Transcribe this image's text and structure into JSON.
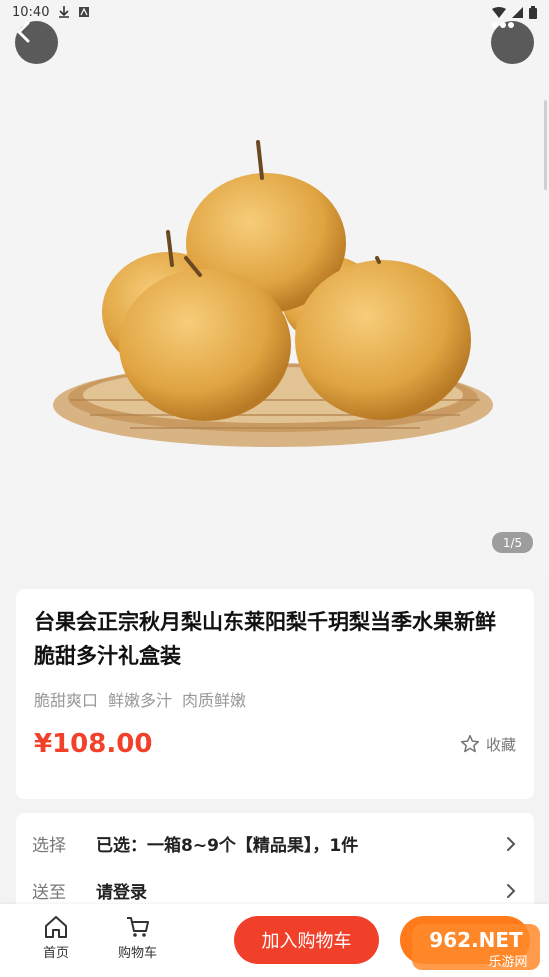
{
  "status_bar": {
    "time": "10:40"
  },
  "gallery": {
    "indicator": "1/5"
  },
  "product": {
    "title": "台果会正宗秋月梨山东莱阳梨千玥梨当季水果新鲜脆甜多汁礼盒装",
    "tags": [
      "脆甜爽口",
      "鲜嫩多汁",
      "肉质鲜嫩"
    ],
    "price": "¥108.00",
    "favorite_label": "收藏"
  },
  "options": {
    "select_label": "选择",
    "select_value": "已选：一箱8~9个【精品果】，1件",
    "ship_label": "送至",
    "ship_value": "请登录"
  },
  "bottom_bar": {
    "home_label": "首页",
    "cart_label": "购物车",
    "add_to_cart_label": "加入购物车",
    "buy_label": ""
  },
  "watermark": {
    "top": "962.NET",
    "bottom": "乐游网"
  },
  "colors": {
    "accent": "#f1402a",
    "buy": "#ff7a1a",
    "price": "#f2412a"
  }
}
